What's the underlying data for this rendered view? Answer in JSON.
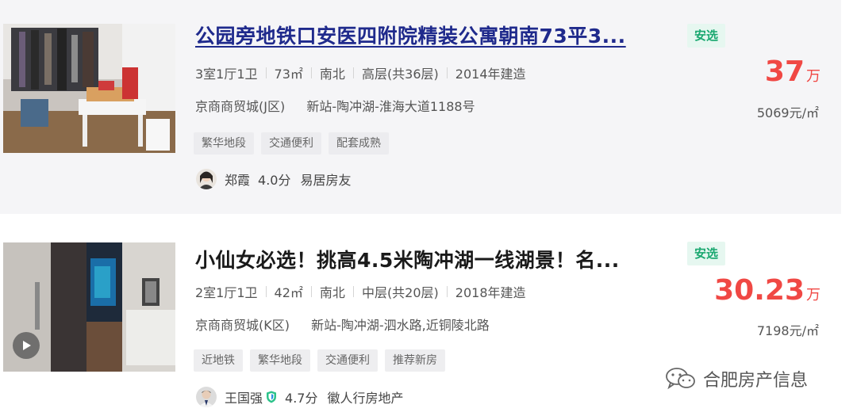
{
  "listings": [
    {
      "title": "公园旁地铁口安医四附院精装公寓朝南73平3...",
      "badge": "安选",
      "layout": "3室1厅1卫",
      "area": "73㎡",
      "orientation": "南北",
      "floor": "高层(共36层)",
      "built": "2014年建造",
      "community": "京商商贸城(J区)",
      "address": "新站-陶冲湖-淮海大道1188号",
      "tags": [
        "繁华地段",
        "交通便利",
        "配套成熟"
      ],
      "agent": {
        "name": "郑霞",
        "score": "4.0分",
        "company": "易居房友"
      },
      "price": "37",
      "price_unit": "万",
      "unit_price": "5069元/㎡"
    },
    {
      "title": "小仙女必选！挑高4.5米陶冲湖一线湖景！名...",
      "badge": "安选",
      "layout": "2室1厅1卫",
      "area": "42㎡",
      "orientation": "南北",
      "floor": "中层(共20层)",
      "built": "2018年建造",
      "community": "京商商贸城(K区)",
      "address": "新站-陶冲湖-泗水路,近铜陵北路",
      "tags": [
        "近地铁",
        "繁华地段",
        "交通便利",
        "推荐新房"
      ],
      "agent": {
        "name": "王国强",
        "score": "4.7分",
        "company": "徽人行房地产"
      },
      "price": "30.23",
      "price_unit": "万",
      "unit_price": "7198元/㎡"
    }
  ],
  "watermark": "合肥房产信息",
  "colors": {
    "price": "#f04844",
    "badge_text": "#1aa870",
    "badge_bg": "#e6f7f0",
    "link": "#1f2a8c"
  }
}
